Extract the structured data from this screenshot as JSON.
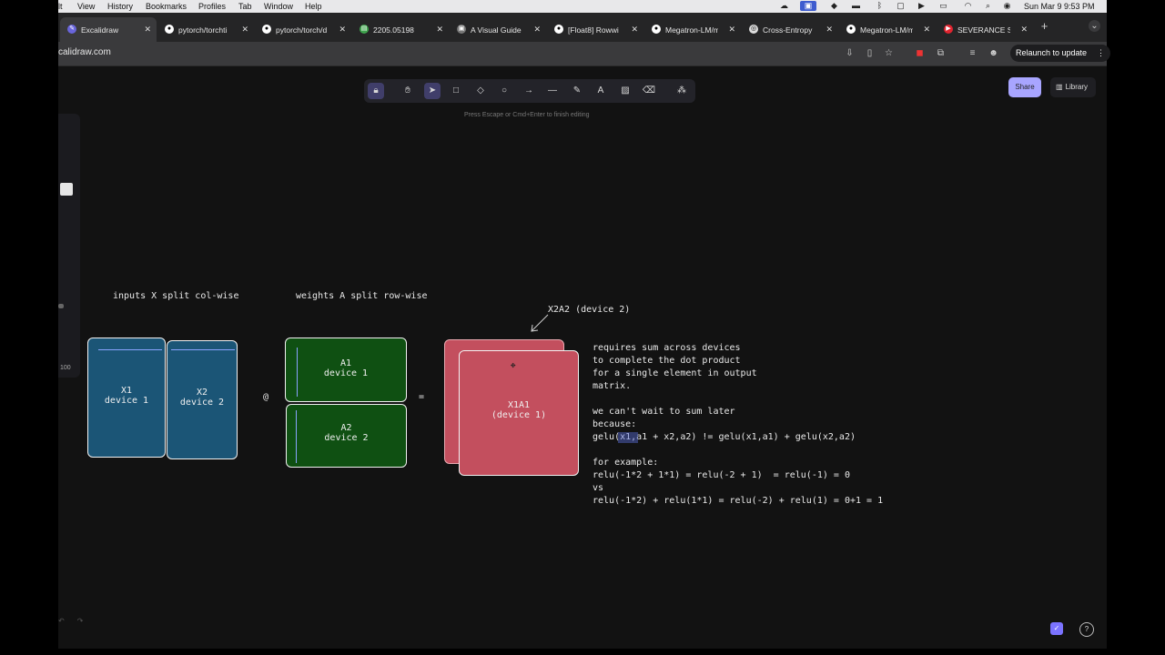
{
  "menubar": {
    "items": [
      "lt",
      "View",
      "History",
      "Bookmarks",
      "Profiles",
      "Tab",
      "Window",
      "Help"
    ],
    "datetime": "Sun Mar 9  9:53 PM"
  },
  "tabs": [
    {
      "title": "Excalidraw",
      "active": true
    },
    {
      "title": "pytorch/torchti"
    },
    {
      "title": "pytorch/torch/d"
    },
    {
      "title": "2205.05198"
    },
    {
      "title": "A Visual Guide i"
    },
    {
      "title": "[Float8] Rowwi"
    },
    {
      "title": "Megatron-LM/m"
    },
    {
      "title": "Cross-Entropy"
    },
    {
      "title": "Megatron-LM/m"
    },
    {
      "title": "SEVERANCE Se"
    }
  ],
  "address": {
    "url": "calidraw.com",
    "relaunch_label": "Relaunch to update"
  },
  "excalidraw": {
    "hint": "Press Escape or Cmd+Enter to finish editing",
    "share_label": "Share",
    "library_label": "Library",
    "zoom": "100",
    "tools": [
      "lock",
      "hand",
      "selection",
      "rectangle",
      "diamond",
      "ellipse",
      "arrow",
      "line",
      "draw",
      "text",
      "image",
      "eraser",
      "more"
    ]
  },
  "drawing": {
    "caption_x": "inputs X split col-wise",
    "caption_a": "weights A split row-wise",
    "x1_label": "X1\ndevice 1",
    "x2_label": "X2\ndevice 2",
    "at_symbol": "@",
    "a1_label": "A1\ndevice 1",
    "a2_label": "A2\ndevice 2",
    "eq_symbol": "=",
    "x2a2_label": "X2A2 (device 2)",
    "x1a1_label": "X1A1\n(device 1)",
    "note": "requires sum across devices\nto complete the dot product\nfor a single element in output\nmatrix.\n\nwe can't wait to sum later\nbecause:\ngelu(x1,a1 + x2,a2) != gelu(x1,a1) + gelu(x2,a2)\n\nfor example:\nrelu(-1*2 + 1*1) = relu(-2 + 1)  = relu(-1) = 0\nvs\nrelu(-1*2) + relu(1*1) = relu(-2) + relu(1) = 0+1 = 1"
  }
}
